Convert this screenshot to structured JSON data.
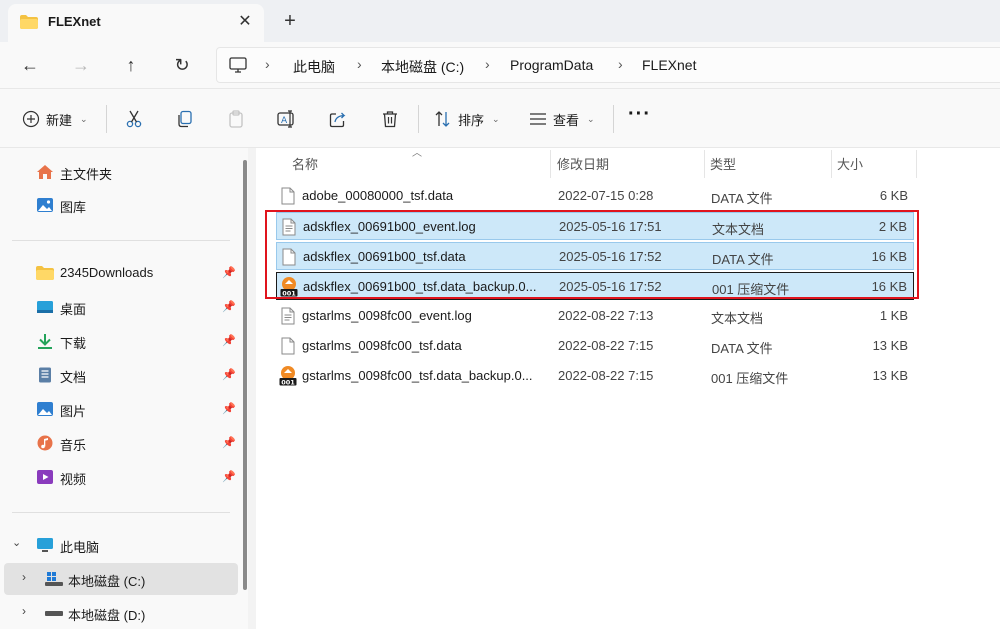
{
  "tab": {
    "title": "FLEXnet",
    "close": "✕",
    "new": "+"
  },
  "nav": {
    "back": "←",
    "forward": "→",
    "up": "↑",
    "refresh": "↻"
  },
  "breadcrumb": [
    "此电脑",
    "本地磁盘 (C:)",
    "ProgramData",
    "FLEXnet"
  ],
  "toolbar": {
    "new_label": "新建",
    "sort_label": "排序",
    "view_label": "查看",
    "more": "···"
  },
  "sidebar": {
    "top": [
      {
        "label": "主文件夹",
        "icon": "home-icon"
      },
      {
        "label": "图库",
        "icon": "gallery-icon"
      }
    ],
    "quick": [
      {
        "label": "2345Downloads",
        "icon": "folder-icon"
      },
      {
        "label": "桌面",
        "icon": "desktop-icon"
      },
      {
        "label": "下载",
        "icon": "download-icon"
      },
      {
        "label": "文档",
        "icon": "document-icon"
      },
      {
        "label": "图片",
        "icon": "pictures-icon"
      },
      {
        "label": "音乐",
        "icon": "music-icon"
      },
      {
        "label": "视频",
        "icon": "video-icon"
      }
    ],
    "pc": {
      "label": "此电脑",
      "drives": [
        {
          "label": "本地磁盘 (C:)"
        },
        {
          "label": "本地磁盘 (D:)"
        }
      ]
    }
  },
  "columns": {
    "name": "名称",
    "date": "修改日期",
    "type": "类型",
    "size": "大小"
  },
  "files": [
    {
      "name": "adobe_00080000_tsf.data",
      "date": "2022-07-15 0:28",
      "type": "DATA 文件",
      "size": "6 KB",
      "icon": "file-icon",
      "selected": false
    },
    {
      "name": "adskflex_00691b00_event.log",
      "date": "2025-05-16 17:51",
      "type": "文本文档",
      "size": "2 KB",
      "icon": "file-icon",
      "selected": true
    },
    {
      "name": "adskflex_00691b00_tsf.data",
      "date": "2025-05-16 17:52",
      "type": "DATA 文件",
      "size": "16 KB",
      "icon": "file-icon",
      "selected": true
    },
    {
      "name": "adskflex_00691b00_tsf.data_backup.0...",
      "date": "2025-05-16 17:52",
      "type": "001 压缩文件",
      "size": "16 KB",
      "icon": "archive-001-icon",
      "selected": true
    },
    {
      "name": "gstarlms_0098fc00_event.log",
      "date": "2022-08-22 7:13",
      "type": "文本文档",
      "size": "1 KB",
      "icon": "file-icon",
      "selected": false
    },
    {
      "name": "gstarlms_0098fc00_tsf.data",
      "date": "2022-08-22 7:15",
      "type": "DATA 文件",
      "size": "13 KB",
      "icon": "file-icon",
      "selected": false
    },
    {
      "name": "gstarlms_0098fc00_tsf.data_backup.0...",
      "date": "2022-08-22 7:15",
      "type": "001 压缩文件",
      "size": "13 KB",
      "icon": "archive-001-icon",
      "selected": false
    }
  ],
  "colors": {
    "selection": "#cde8f9",
    "highlight_box": "#e0141d",
    "folder": "#f4c242"
  }
}
